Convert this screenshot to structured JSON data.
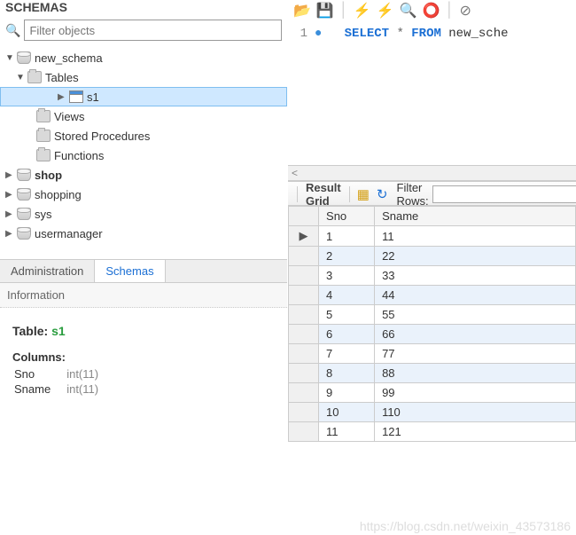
{
  "header": {
    "title": "SCHEMAS"
  },
  "filter": {
    "placeholder": "Filter objects"
  },
  "tree": {
    "schemas": [
      {
        "name": "new_schema",
        "open": true,
        "bold": false
      },
      {
        "name": "shop",
        "bold": true
      },
      {
        "name": "shopping"
      },
      {
        "name": "sys"
      },
      {
        "name": "usermanager"
      }
    ],
    "new_schema_children": [
      {
        "name": "Tables",
        "kind": "folder",
        "open": true
      },
      {
        "name": "Views",
        "kind": "view"
      },
      {
        "name": "Stored Procedures",
        "kind": "proc"
      },
      {
        "name": "Functions",
        "kind": "func"
      }
    ],
    "tables": [
      {
        "name": "s1"
      }
    ]
  },
  "tabs": {
    "admin": "Administration",
    "schemas": "Schemas"
  },
  "info": {
    "section": "Information",
    "table_label": "Table:",
    "table_name": "s1",
    "columns_label": "Columns:",
    "columns": [
      {
        "name": "Sno",
        "type": "int(11)"
      },
      {
        "name": "Sname",
        "type": "int(11)"
      }
    ]
  },
  "editor": {
    "line_no": "1",
    "sql_kw1": "SELECT",
    "sql_star": "*",
    "sql_kw2": "FROM",
    "sql_ident": "new_sche"
  },
  "result_bar": {
    "label": "Result Grid",
    "filter_label": "Filter Rows:",
    "filter_value": ""
  },
  "result": {
    "headers": [
      "Sno",
      "Sname"
    ],
    "rows": [
      [
        "1",
        "11"
      ],
      [
        "2",
        "22"
      ],
      [
        "3",
        "33"
      ],
      [
        "4",
        "44"
      ],
      [
        "5",
        "55"
      ],
      [
        "6",
        "66"
      ],
      [
        "7",
        "77"
      ],
      [
        "8",
        "88"
      ],
      [
        "9",
        "99"
      ],
      [
        "10",
        "110"
      ],
      [
        "11",
        "121"
      ]
    ]
  },
  "watermark": "https://blog.csdn.net/weixin_43573186"
}
